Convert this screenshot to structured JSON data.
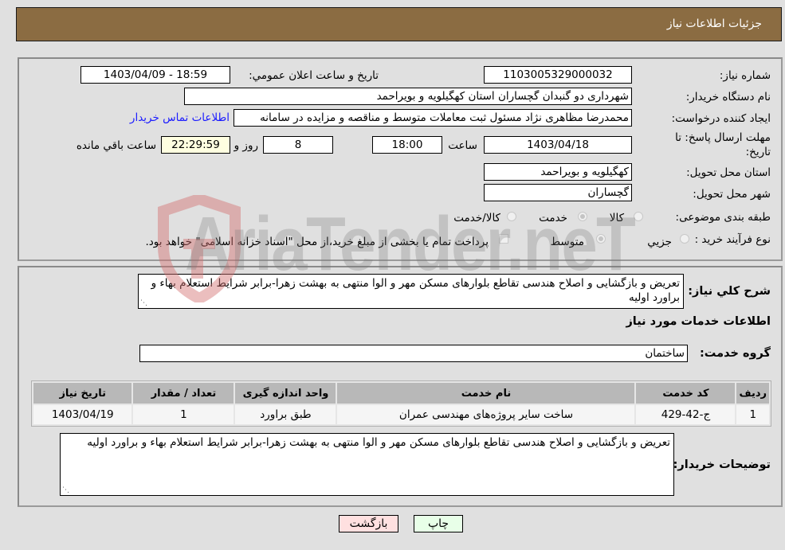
{
  "header": {
    "title": "جزئیات اطلاعات نیاز"
  },
  "form": {
    "need_number_label": "شماره نیاز:",
    "need_number": "1103005329000032",
    "announce_label": "تاريخ و ساعت اعلان عمومي:",
    "announce_value": "1403/04/09 - 18:59",
    "buyer_org_label": "نام دستگاه خريدار:",
    "buyer_org": "شهرداری دو گنبدان گچساران استان کهگیلویه و بویراحمد",
    "creator_label": "ايجاد کننده درخواست:",
    "creator": "محمدرضا مظاهری نژاد مسئول ثبت معاملات متوسط و مناقصه و مزایده در سامانه",
    "buyer_contact_link": "اطلاعات تماس خريدار",
    "deadline_label_1": "مهلت ارسال پاسخ: تا",
    "deadline_label_2": "تاريخ:",
    "deadline_date": "1403/04/18",
    "time_label": "ساعت",
    "deadline_time": "18:00",
    "days_value": "8",
    "days_label": "روز و",
    "remaining_time": "22:29:59",
    "remaining_label": "ساعت باقي مانده",
    "province_label": "استان محل تحويل:",
    "province": "کهگیلویه و بویراحمد",
    "city_label": "شهر محل تحويل:",
    "city": "گچساران",
    "category_label": "طبقه بندی موضوعی:",
    "category_options": [
      {
        "label": "کالا",
        "selected": false
      },
      {
        "label": "خدمت",
        "selected": true
      },
      {
        "label": "کالا/خدمت",
        "selected": false
      }
    ],
    "process_label": "نوع فرآيند خريد :",
    "process_options": [
      {
        "label": "جزيي",
        "selected": false
      },
      {
        "label": "متوسط",
        "selected": true
      }
    ],
    "treasury_checkbox_checked": false,
    "treasury_note": "پرداخت تمام يا بخشی از مبلغ خريد،از محل \"اسناد خزانه اسلامی\" خواهد بود."
  },
  "details": {
    "summary_label": "شرح کلي نياز:",
    "summary": "تعریض و بازگشایی و اصلاح هندسی تقاطع بلوارهای مسکن مهر و الوا منتهی به بهشت زهرا-برابر شرایط استعلام بهاء و براورد اولیه",
    "services_heading": "اطلاعات خدمات مورد نياز",
    "service_group_label": "گروه خدمت:",
    "service_group": "ساختمان",
    "table": {
      "headers": [
        "رديف",
        "کد خدمت",
        "نام خدمت",
        "واحد اندازه گيری",
        "تعداد / مقدار",
        "تاريخ نياز"
      ],
      "rows": [
        [
          "1",
          "ج-42-429",
          "ساخت سایر پروژه‌های مهندسی عمران",
          "طبق براورد",
          "1",
          "1403/04/19"
        ]
      ]
    },
    "buyer_notes_label": "توضيحات خريدار:",
    "buyer_notes": "تعریض و بازگشایی و اصلاح هندسی تقاطع بلوارهای مسکن مهر و الوا منتهی به بهشت زهرا-برابر شرایط استعلام بهاء و براورد اولیه"
  },
  "buttons": {
    "print": "چاپ",
    "back": "بازگشت"
  },
  "watermark": {
    "text": "AriaTender.neT"
  },
  "colors": {
    "header_bg": "#8b6c42",
    "link": "#1a1aff",
    "back_btn": "#ffe0e0",
    "print_btn": "#e8ffe8",
    "remaining_bg": "#ffffe1"
  }
}
